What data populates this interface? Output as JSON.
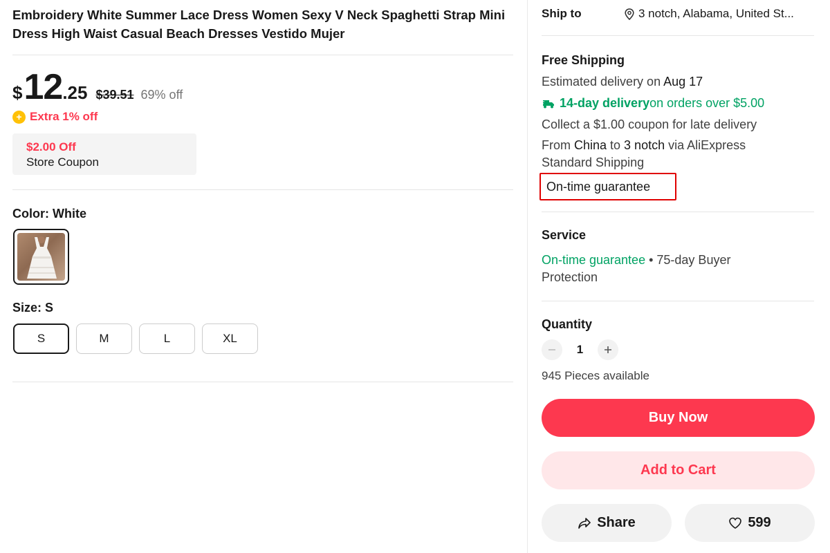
{
  "product": {
    "title": "Embroidery White Summer Lace Dress Women Sexy V Neck Spaghetti Strap Mini Dress High Waist Casual Beach Dresses Vestido Mujer"
  },
  "price": {
    "currency": "$",
    "integer": "12",
    "decimal": ".25",
    "original": "$39.51",
    "discount": "69% off",
    "extra": "Extra 1% off"
  },
  "coupon": {
    "amount": "$2.00 Off",
    "label": "Store Coupon"
  },
  "color": {
    "label": "Color: White",
    "selected": "White"
  },
  "size": {
    "label": "Size: S",
    "options": [
      "S",
      "M",
      "L",
      "XL"
    ],
    "selected": "S"
  },
  "shipping": {
    "ship_to_label": "Ship to",
    "location": "3 notch, Alabama, United St...",
    "free_label": "Free Shipping",
    "estimated_prefix": "Estimated delivery on ",
    "estimated_date": "Aug 17",
    "fast_delivery": "14-day delivery",
    "fast_suffix": " on orders over $5.00",
    "late_coupon": "Collect a $1.00 coupon for late delivery",
    "from_prefix": "From ",
    "from_country": "China",
    "to_word": " to ",
    "to_place": "3 notch",
    "via_text": " via AliExpress",
    "method_line2": "Standard Shipping",
    "guarantee_tag": "On-time guarantee"
  },
  "service": {
    "heading": "Service",
    "guarantee": "On-time guarantee",
    "protection_line1": " • 75-day Buyer",
    "protection_line2": "Protection"
  },
  "quantity": {
    "heading": "Quantity",
    "value": "1",
    "available": "945 Pieces available"
  },
  "actions": {
    "buy_now": "Buy Now",
    "add_to_cart": "Add to Cart",
    "share": "Share",
    "wishlist_count": "599"
  },
  "colors": {
    "accent": "#fd384f",
    "accent_light": "#ffe7e9",
    "green": "#00a263",
    "highlight_box": "#e00000"
  }
}
